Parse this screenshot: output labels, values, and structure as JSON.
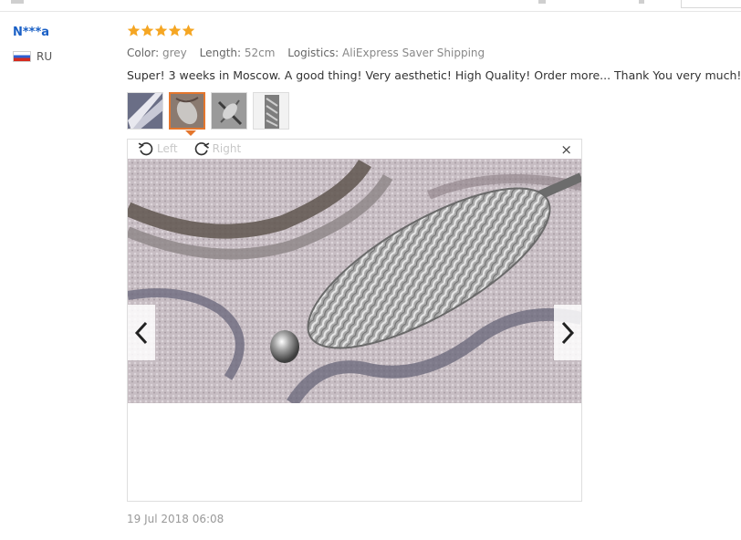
{
  "reviewer": {
    "name": "N***a",
    "country_code": "RU"
  },
  "rating": {
    "stars": 5,
    "max": 5,
    "color": "#f5a623"
  },
  "attributes": [
    {
      "key": "Color:",
      "value": "grey"
    },
    {
      "key": "Length:",
      "value": "52cm"
    },
    {
      "key": "Logistics:",
      "value": "AliExpress Saver Shipping"
    }
  ],
  "review_text": "Super! 3 weeks in Moscow. A good thing! Very aesthetic! High Quality! Order more... Thank You very much!",
  "thumbnails": {
    "count": 4,
    "active_index": 1
  },
  "viewer": {
    "rotate_left_label": "Left",
    "rotate_right_label": "Right",
    "close_symbol": "×",
    "prev_icon": "chevron-left-icon",
    "next_icon": "chevron-right-icon"
  },
  "date": "19 Jul 2018 06:08",
  "colors": {
    "link": "#1a60c6",
    "accent": "#e4762d"
  }
}
